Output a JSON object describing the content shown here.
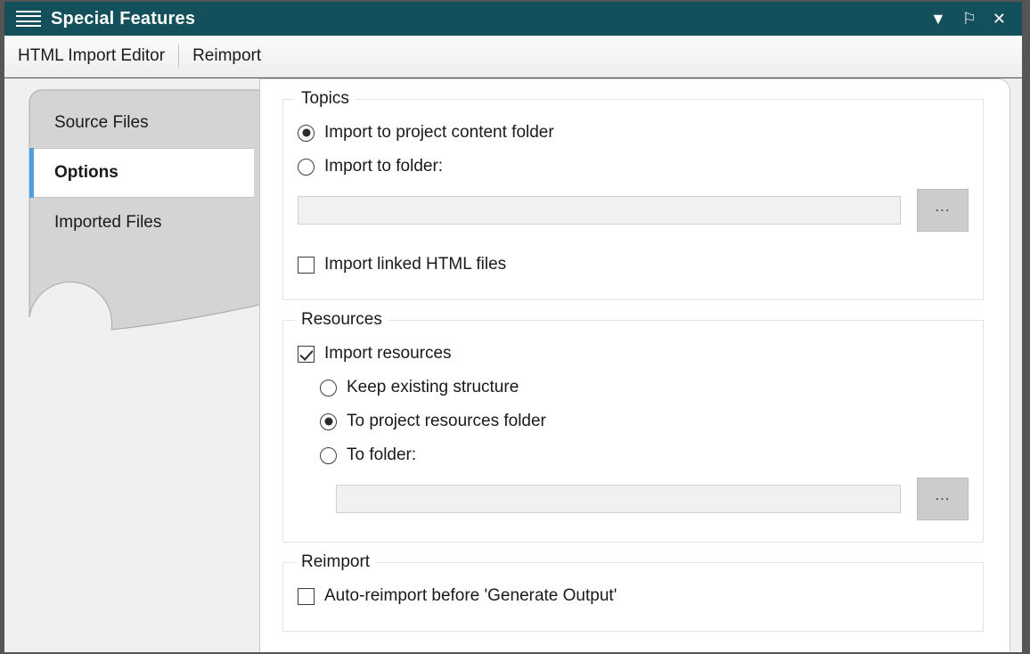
{
  "window": {
    "title": "Special Features",
    "menu_icon": "hamburger-icon",
    "controls": [
      {
        "name": "dropdown-chevron",
        "glyph": "▼"
      },
      {
        "name": "pin",
        "glyph": "⚐"
      },
      {
        "name": "close",
        "glyph": "✕"
      }
    ]
  },
  "toolbar": {
    "items": [
      {
        "label": "HTML Import Editor"
      },
      {
        "label": "Reimport"
      }
    ]
  },
  "tabs": [
    {
      "label": "Source Files",
      "selected": false
    },
    {
      "label": "Options",
      "selected": true
    },
    {
      "label": "Imported Files",
      "selected": false
    }
  ],
  "groups": {
    "topics": {
      "title": "Topics",
      "radio_project_content": {
        "label": "Import to project content folder",
        "checked": true
      },
      "radio_to_folder": {
        "label": "Import to folder:",
        "checked": false
      },
      "folder_field": {
        "value": "",
        "placeholder": ""
      },
      "browse_label": "...",
      "checkbox_linked_html": {
        "label": "Import linked HTML files",
        "checked": false
      }
    },
    "resources": {
      "title": "Resources",
      "checkbox_import_resources": {
        "label": "Import resources",
        "checked": true
      },
      "radio_keep_structure": {
        "label": "Keep existing structure",
        "checked": false
      },
      "radio_project_resources": {
        "label": "To project resources folder",
        "checked": true
      },
      "radio_to_folder": {
        "label": "To folder:",
        "checked": false
      },
      "folder_field": {
        "value": "",
        "placeholder": ""
      },
      "browse_label": "..."
    },
    "reimport": {
      "title": "Reimport",
      "checkbox_auto_reimport": {
        "label": "Auto-reimport before 'Generate Output'",
        "checked": false
      }
    }
  },
  "colors": {
    "title_bar": "#14505c",
    "accent_selected_tab": "#4d9fe0",
    "window_border": "#555555",
    "tab_panel": "#d4d4d4",
    "content_bg": "#ffffff"
  }
}
